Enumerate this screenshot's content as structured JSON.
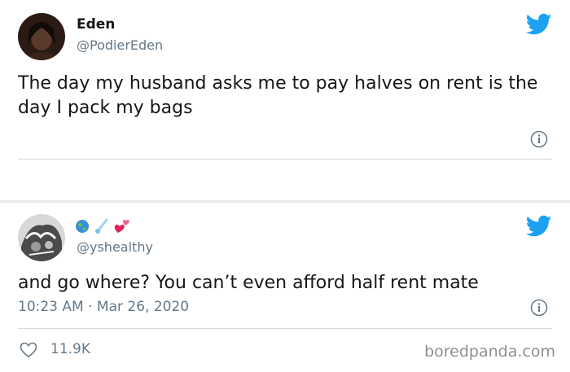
{
  "tweet1": {
    "name": "Eden",
    "handle": "@PodierEden",
    "text": "The day my husband asks me to pay halves on rent is the day I pack my bags"
  },
  "tweet2": {
    "handle": "@yshealthy",
    "text": "and go where? You can’t even afford half rent mate",
    "timestamp": "10:23 AM · Mar 26, 2020",
    "likes": "11.9K"
  },
  "watermark": "boredpanda.com",
  "colors": {
    "twitter_blue": "#1da1f2",
    "secondary_text": "#657786",
    "divider": "#d5d9de"
  },
  "icons": [
    "twitter-bird-icon",
    "info-icon",
    "heart-icon",
    "globe-emoji-icon",
    "comet-emoji-icon",
    "hearts-emoji-icon"
  ]
}
